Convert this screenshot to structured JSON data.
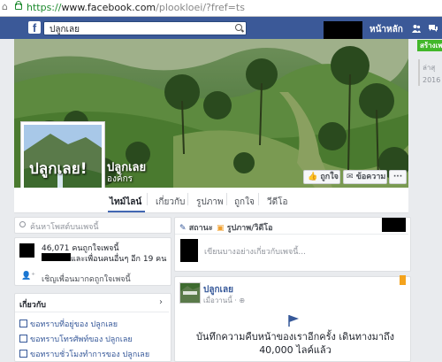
{
  "browser": {
    "url_scheme": "https://",
    "url_domain": "www.facebook.com",
    "url_path": "/plookloei/?fref=ts",
    "nav_glyph": "⌂"
  },
  "fb_bar": {
    "logo": "f",
    "search_value": "ปลูกเลย",
    "home_label": "หน้าหลัก",
    "icons": [
      "friends-icon",
      "messages-icon"
    ]
  },
  "page": {
    "name": "ปลูกเลย",
    "category": "องค์กร",
    "profile_text": "ปลูกเลย!",
    "buttons": {
      "like": "ถูกใจ",
      "message": "ข้อความ",
      "more": "···"
    },
    "tabs": [
      "ไทม์ไลน์",
      "เกี่ยวกับ",
      "รูปภาพ",
      "ถูกใจ",
      "วีดีโอ"
    ]
  },
  "right_strip": {
    "create_label": "สร้างเพ",
    "item1": "ล่าสุ",
    "item2": "2016"
  },
  "left": {
    "search_placeholder": "ค้นหาโพสต์บนเพจนี้",
    "likes_count": "46,071 คนถูกใจเพจนี้",
    "friends_like": "และเพื่อนคนอื่นๆ อีก 19 คน",
    "invite": "เชิญเพื่อนมากดถูกใจเพจนี้",
    "about_header": "เกี่ยวกับ",
    "about_items": [
      "ขอทราบที่อยู่ของ ปลูกเลย",
      "ขอทราบโทรศัพท์ของ ปลูกเลย",
      "ขอทราบชั่วโมงทำการของ ปลูกเลย"
    ]
  },
  "composer": {
    "status_label": "สถานะ",
    "photo_label": "รูปภาพ/วิดีโอ",
    "placeholder": "เขียนบางอย่างเกี่ยวกับเพจนี้..."
  },
  "post": {
    "author": "ปลูกเลย",
    "time": "เมื่อวานนี้ · ⊕",
    "text": "บันทึกความคืบหน้าของเราอีกครั้ง เดินทางมาถึง 40,000 ไลค์แล้ว"
  },
  "colors": {
    "fb_blue": "#3b5998",
    "link": "#365899",
    "green_btn": "#42b72a"
  }
}
